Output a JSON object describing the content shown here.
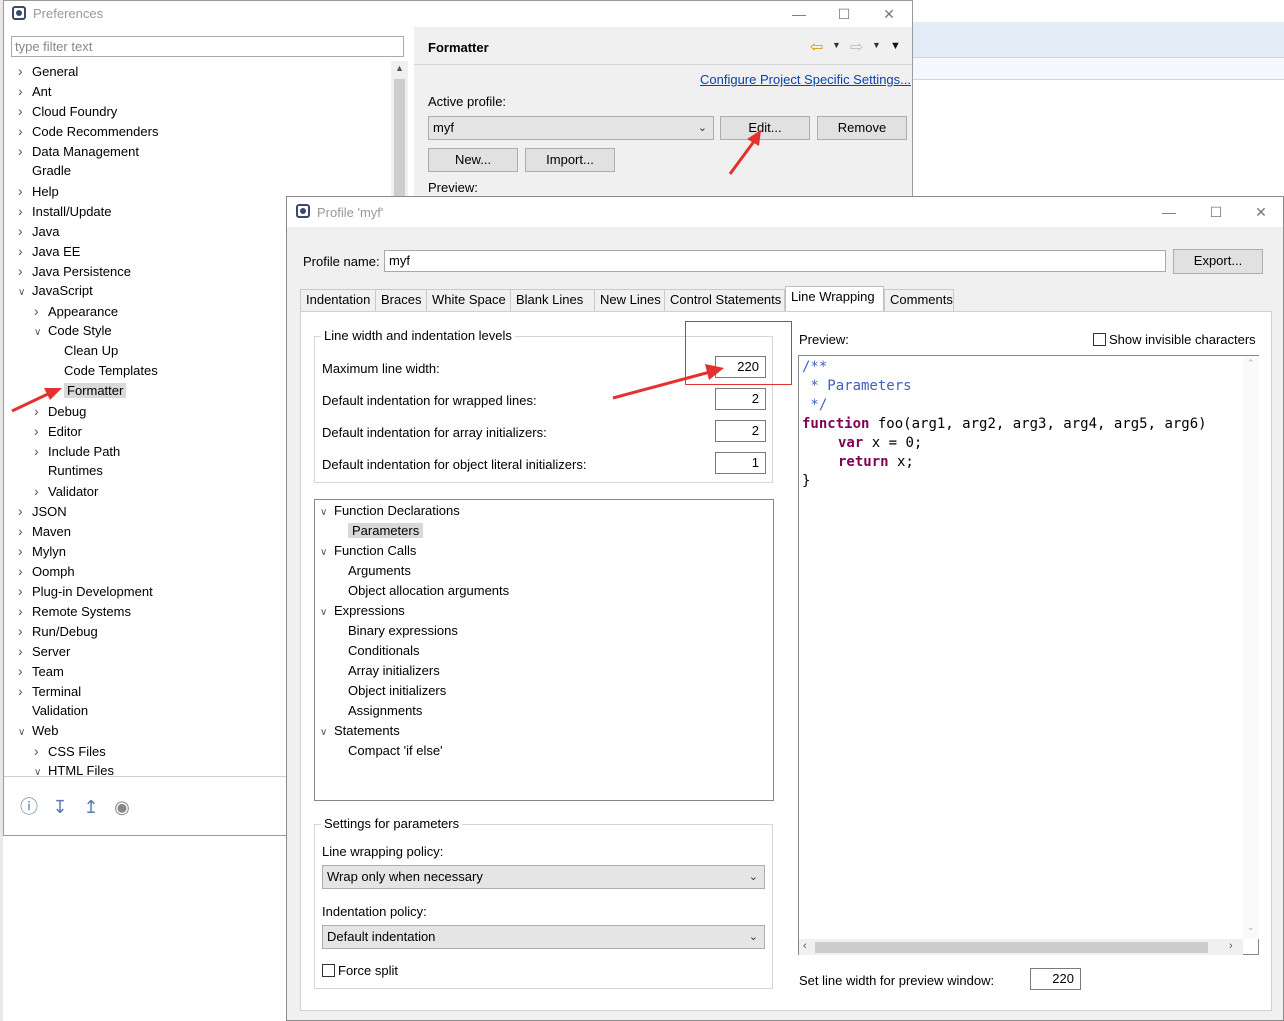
{
  "preferences": {
    "title": "Preferences",
    "filter_placeholder": "type filter text",
    "tree": [
      {
        "label": "General",
        "expanded": false
      },
      {
        "label": "Ant",
        "expanded": false
      },
      {
        "label": "Cloud Foundry",
        "expanded": false
      },
      {
        "label": "Code Recommenders",
        "expanded": false
      },
      {
        "label": "Data Management",
        "expanded": false
      },
      {
        "label": "Gradle",
        "leaf": true
      },
      {
        "label": "Help",
        "expanded": false
      },
      {
        "label": "Install/Update",
        "expanded": false
      },
      {
        "label": "Java",
        "expanded": false
      },
      {
        "label": "Java EE",
        "expanded": false
      },
      {
        "label": "Java Persistence",
        "expanded": false
      },
      {
        "label": "JavaScript",
        "expanded": true
      },
      {
        "label": "Appearance",
        "expanded": false,
        "level": 1
      },
      {
        "label": "Code Style",
        "expanded": true,
        "level": 1
      },
      {
        "label": "Clean Up",
        "leaf": true,
        "level": 2
      },
      {
        "label": "Code Templates",
        "leaf": true,
        "level": 2
      },
      {
        "label": "Formatter",
        "leaf": true,
        "level": 2,
        "selected": true
      },
      {
        "label": "Debug",
        "expanded": false,
        "level": 1
      },
      {
        "label": "Editor",
        "expanded": false,
        "level": 1
      },
      {
        "label": "Include Path",
        "expanded": false,
        "level": 1
      },
      {
        "label": "Runtimes",
        "leaf": true,
        "level": 1
      },
      {
        "label": "Validator",
        "expanded": false,
        "level": 1
      },
      {
        "label": "JSON",
        "expanded": false
      },
      {
        "label": "Maven",
        "expanded": false
      },
      {
        "label": "Mylyn",
        "expanded": false
      },
      {
        "label": "Oomph",
        "expanded": false
      },
      {
        "label": "Plug-in Development",
        "expanded": false
      },
      {
        "label": "Remote Systems",
        "expanded": false
      },
      {
        "label": "Run/Debug",
        "expanded": false
      },
      {
        "label": "Server",
        "expanded": false
      },
      {
        "label": "Team",
        "expanded": false
      },
      {
        "label": "Terminal",
        "expanded": false
      },
      {
        "label": "Validation",
        "leaf": true
      },
      {
        "label": "Web",
        "expanded": true
      },
      {
        "label": "CSS Files",
        "expanded": false,
        "level": 1
      },
      {
        "label": "HTML Files",
        "expanded": true,
        "level": 1
      }
    ],
    "page_title": "Formatter",
    "configure_link": "Configure Project Specific Settings...",
    "active_profile_label": "Active profile:",
    "active_profile_value": "myf",
    "edit_button": "Edit...",
    "remove_button": "Remove",
    "new_button": "New...",
    "import_button": "Import...",
    "preview_label": "Preview:"
  },
  "profile_dialog": {
    "title": "Profile 'myf'",
    "profile_name_label": "Profile name:",
    "profile_name_value": "myf",
    "export_button": "Export...",
    "tabs": [
      {
        "label": "Indentation"
      },
      {
        "label": "Braces"
      },
      {
        "label": "White Space"
      },
      {
        "label": "Blank Lines"
      },
      {
        "label": "New Lines"
      },
      {
        "label": "Control Statements"
      },
      {
        "label": "Line Wrapping",
        "active": true
      },
      {
        "label": "Comments"
      }
    ],
    "line_width_group": "Line width and indentation levels",
    "max_line_width_label": "Maximum line width:",
    "max_line_width_value": "220",
    "wrapped_indent_label": "Default indentation for wrapped lines:",
    "wrapped_indent_value": "2",
    "array_indent_label": "Default indentation for array initializers:",
    "array_indent_value": "2",
    "object_indent_label": "Default indentation for object literal initializers:",
    "object_indent_value": "1",
    "categories": [
      {
        "label": "Function Declarations",
        "group": true
      },
      {
        "label": "Parameters",
        "selected": true
      },
      {
        "label": "Function Calls",
        "group": true
      },
      {
        "label": "Arguments"
      },
      {
        "label": "Object allocation arguments"
      },
      {
        "label": "Expressions",
        "group": true
      },
      {
        "label": "Binary expressions"
      },
      {
        "label": "Conditionals"
      },
      {
        "label": "Array initializers"
      },
      {
        "label": "Object initializers"
      },
      {
        "label": "Assignments"
      },
      {
        "label": "Statements",
        "group": true
      },
      {
        "label": "Compact 'if else'"
      }
    ],
    "settings_group": "Settings for parameters",
    "wrap_policy_label": "Line wrapping policy:",
    "wrap_policy_value": "Wrap only when necessary",
    "indent_policy_label": "Indentation policy:",
    "indent_policy_value": "Default indentation",
    "force_split_label": "Force split",
    "preview_label": "Preview:",
    "show_invisible_label": "Show invisible characters",
    "code_lines": {
      "l1": "/**",
      "l2": " * Parameters",
      "l3": " */",
      "l4_kw": "function",
      "l4_rest": " foo(arg1, arg2, arg3, arg4, arg5, arg6)",
      "l5_kw": "var",
      "l5_rest": " x = 0;",
      "l6_kw": "return",
      "l6_rest": " x;",
      "l7": "}"
    },
    "preview_width_label": "Set line width for preview window:",
    "preview_width_value": "220"
  },
  "colors": {
    "annotation_red": "#e53030",
    "keyword": "#7f0055",
    "comment": "#3f5fbf",
    "link": "#0645ad"
  }
}
